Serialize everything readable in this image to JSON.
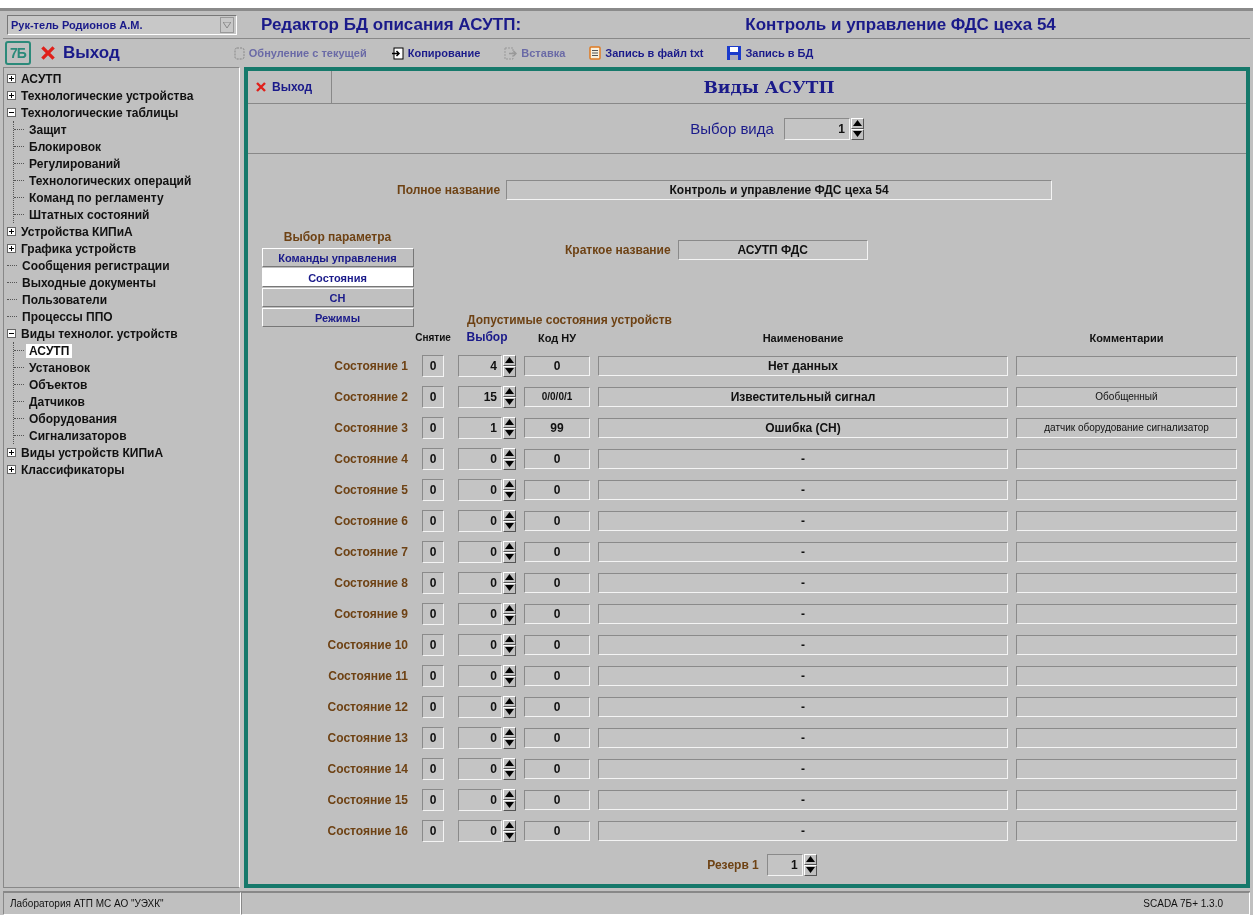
{
  "user_select": {
    "value": "Рук-тель Родионов А.М."
  },
  "title": {
    "left": "Редактор БД описания АСУТП:",
    "right": "Контроль и управление ФДС цеха 54"
  },
  "toolbar": {
    "logo": "7Б",
    "exit": "Выход",
    "actions": [
      {
        "kind": "reset",
        "label": "Обнуление с текущей",
        "disabled": true
      },
      {
        "kind": "copy",
        "label": "Копирование",
        "disabled": false
      },
      {
        "kind": "paste",
        "label": "Вставка",
        "disabled": true
      },
      {
        "kind": "textfile",
        "label": "Запись в файл txt",
        "disabled": false
      },
      {
        "kind": "save",
        "label": "Запись в БД",
        "disabled": false
      }
    ]
  },
  "sidebar": {
    "items": [
      {
        "label": "АСУТП",
        "expanded": false,
        "selected": false
      },
      {
        "label": "Технологические устройства",
        "expanded": false,
        "selected": false
      },
      {
        "label": "Технологические таблицы",
        "expanded": true,
        "selected": false,
        "children": [
          {
            "label": "Защит",
            "selected": false
          },
          {
            "label": "Блокировок",
            "selected": false
          },
          {
            "label": "Регулирований",
            "selected": false
          },
          {
            "label": "Технологических операций",
            "selected": false
          },
          {
            "label": "Команд по регламенту",
            "selected": false
          },
          {
            "label": "Штатных состояний",
            "selected": false
          }
        ]
      },
      {
        "label": "Устройства КИПиА",
        "expanded": false,
        "selected": false
      },
      {
        "label": "Графика устройств",
        "expanded": false,
        "selected": false
      },
      {
        "label": "Сообщения регистрации",
        "selected": false
      },
      {
        "label": "Выходные документы",
        "selected": false
      },
      {
        "label": "Пользователи",
        "selected": false
      },
      {
        "label": "Процессы ППО",
        "selected": false
      },
      {
        "label": "Виды технолог. устройств",
        "expanded": true,
        "selected": false,
        "children": [
          {
            "label": "АСУТП",
            "selected": true
          },
          {
            "label": "Установок",
            "selected": false
          },
          {
            "label": "Объектов",
            "selected": false
          },
          {
            "label": "Датчиков",
            "selected": false
          },
          {
            "label": "Оборудования",
            "selected": false
          },
          {
            "label": "Сигнализаторов",
            "selected": false
          }
        ]
      },
      {
        "label": "Виды устройств КИПиА",
        "expanded": false,
        "selected": false
      },
      {
        "label": "Классификаторы",
        "expanded": false,
        "selected": false
      }
    ]
  },
  "panel": {
    "exit": "Выход",
    "title": "Виды АСУТП",
    "view_select": {
      "label": "Выбор вида",
      "value": "1"
    },
    "full_name": {
      "label": "Полное название",
      "value": "Контроль и управление ФДС цеха 54"
    },
    "short_name": {
      "label": "Краткое название",
      "value": "АСУТП ФДС"
    },
    "param_select": {
      "title": "Выбор параметра",
      "tabs": [
        {
          "label": "Команды управления",
          "selected": false
        },
        {
          "label": "Состояния",
          "selected": true
        },
        {
          "label": "СН",
          "selected": false
        },
        {
          "label": "Режимы",
          "selected": false
        }
      ]
    },
    "states": {
      "title": "Допустимые состояния устройств",
      "columns": [
        "Снятие",
        "Выбор",
        "Код НУ",
        "Наименование",
        "Комментарии"
      ],
      "rows": [
        {
          "label": "Состояние 1",
          "removal": "0",
          "choice": "4",
          "code": "0",
          "name": "Нет данных"
        },
        {
          "label": "Состояние 2",
          "removal": "0",
          "choice": "15",
          "code": "0/0/0/1",
          "name": "Известительный сигнал",
          "comment": "Обобщенный"
        },
        {
          "label": "Состояние 3",
          "removal": "0",
          "choice": "1",
          "code": "99",
          "name": "Ошибка (СН)",
          "comment": "датчик оборудование сигнализатор"
        },
        {
          "label": "Состояние 4",
          "removal": "0",
          "choice": "0",
          "code": "0",
          "name": "-"
        },
        {
          "label": "Состояние 5",
          "removal": "0",
          "choice": "0",
          "code": "0",
          "name": "-"
        },
        {
          "label": "Состояние 6",
          "removal": "0",
          "choice": "0",
          "code": "0",
          "name": "-"
        },
        {
          "label": "Состояние 7",
          "removal": "0",
          "choice": "0",
          "code": "0",
          "name": "-"
        },
        {
          "label": "Состояние 8",
          "removal": "0",
          "choice": "0",
          "code": "0",
          "name": "-"
        },
        {
          "label": "Состояние 9",
          "removal": "0",
          "choice": "0",
          "code": "0",
          "name": "-"
        },
        {
          "label": "Состояние 10",
          "removal": "0",
          "choice": "0",
          "code": "0",
          "name": "-"
        },
        {
          "label": "Состояние 11",
          "removal": "0",
          "choice": "0",
          "code": "0",
          "name": "-"
        },
        {
          "label": "Состояние 12",
          "removal": "0",
          "choice": "0",
          "code": "0",
          "name": "-"
        },
        {
          "label": "Состояние 13",
          "removal": "0",
          "choice": "0",
          "code": "0",
          "name": "-"
        },
        {
          "label": "Состояние 14",
          "removal": "0",
          "choice": "0",
          "code": "0",
          "name": "-"
        },
        {
          "label": "Состояние 15",
          "removal": "0",
          "choice": "0",
          "code": "0",
          "name": "-"
        },
        {
          "label": "Состояние 16",
          "removal": "0",
          "choice": "0",
          "code": "0",
          "name": "-"
        }
      ]
    },
    "reserve": {
      "label": "Резерв 1",
      "value": "1"
    }
  },
  "status_bar": {
    "left": "Лаборатория АТП МС АО \"УЭХК\"",
    "right": "SCADA 7Б+ 1.3.0"
  }
}
